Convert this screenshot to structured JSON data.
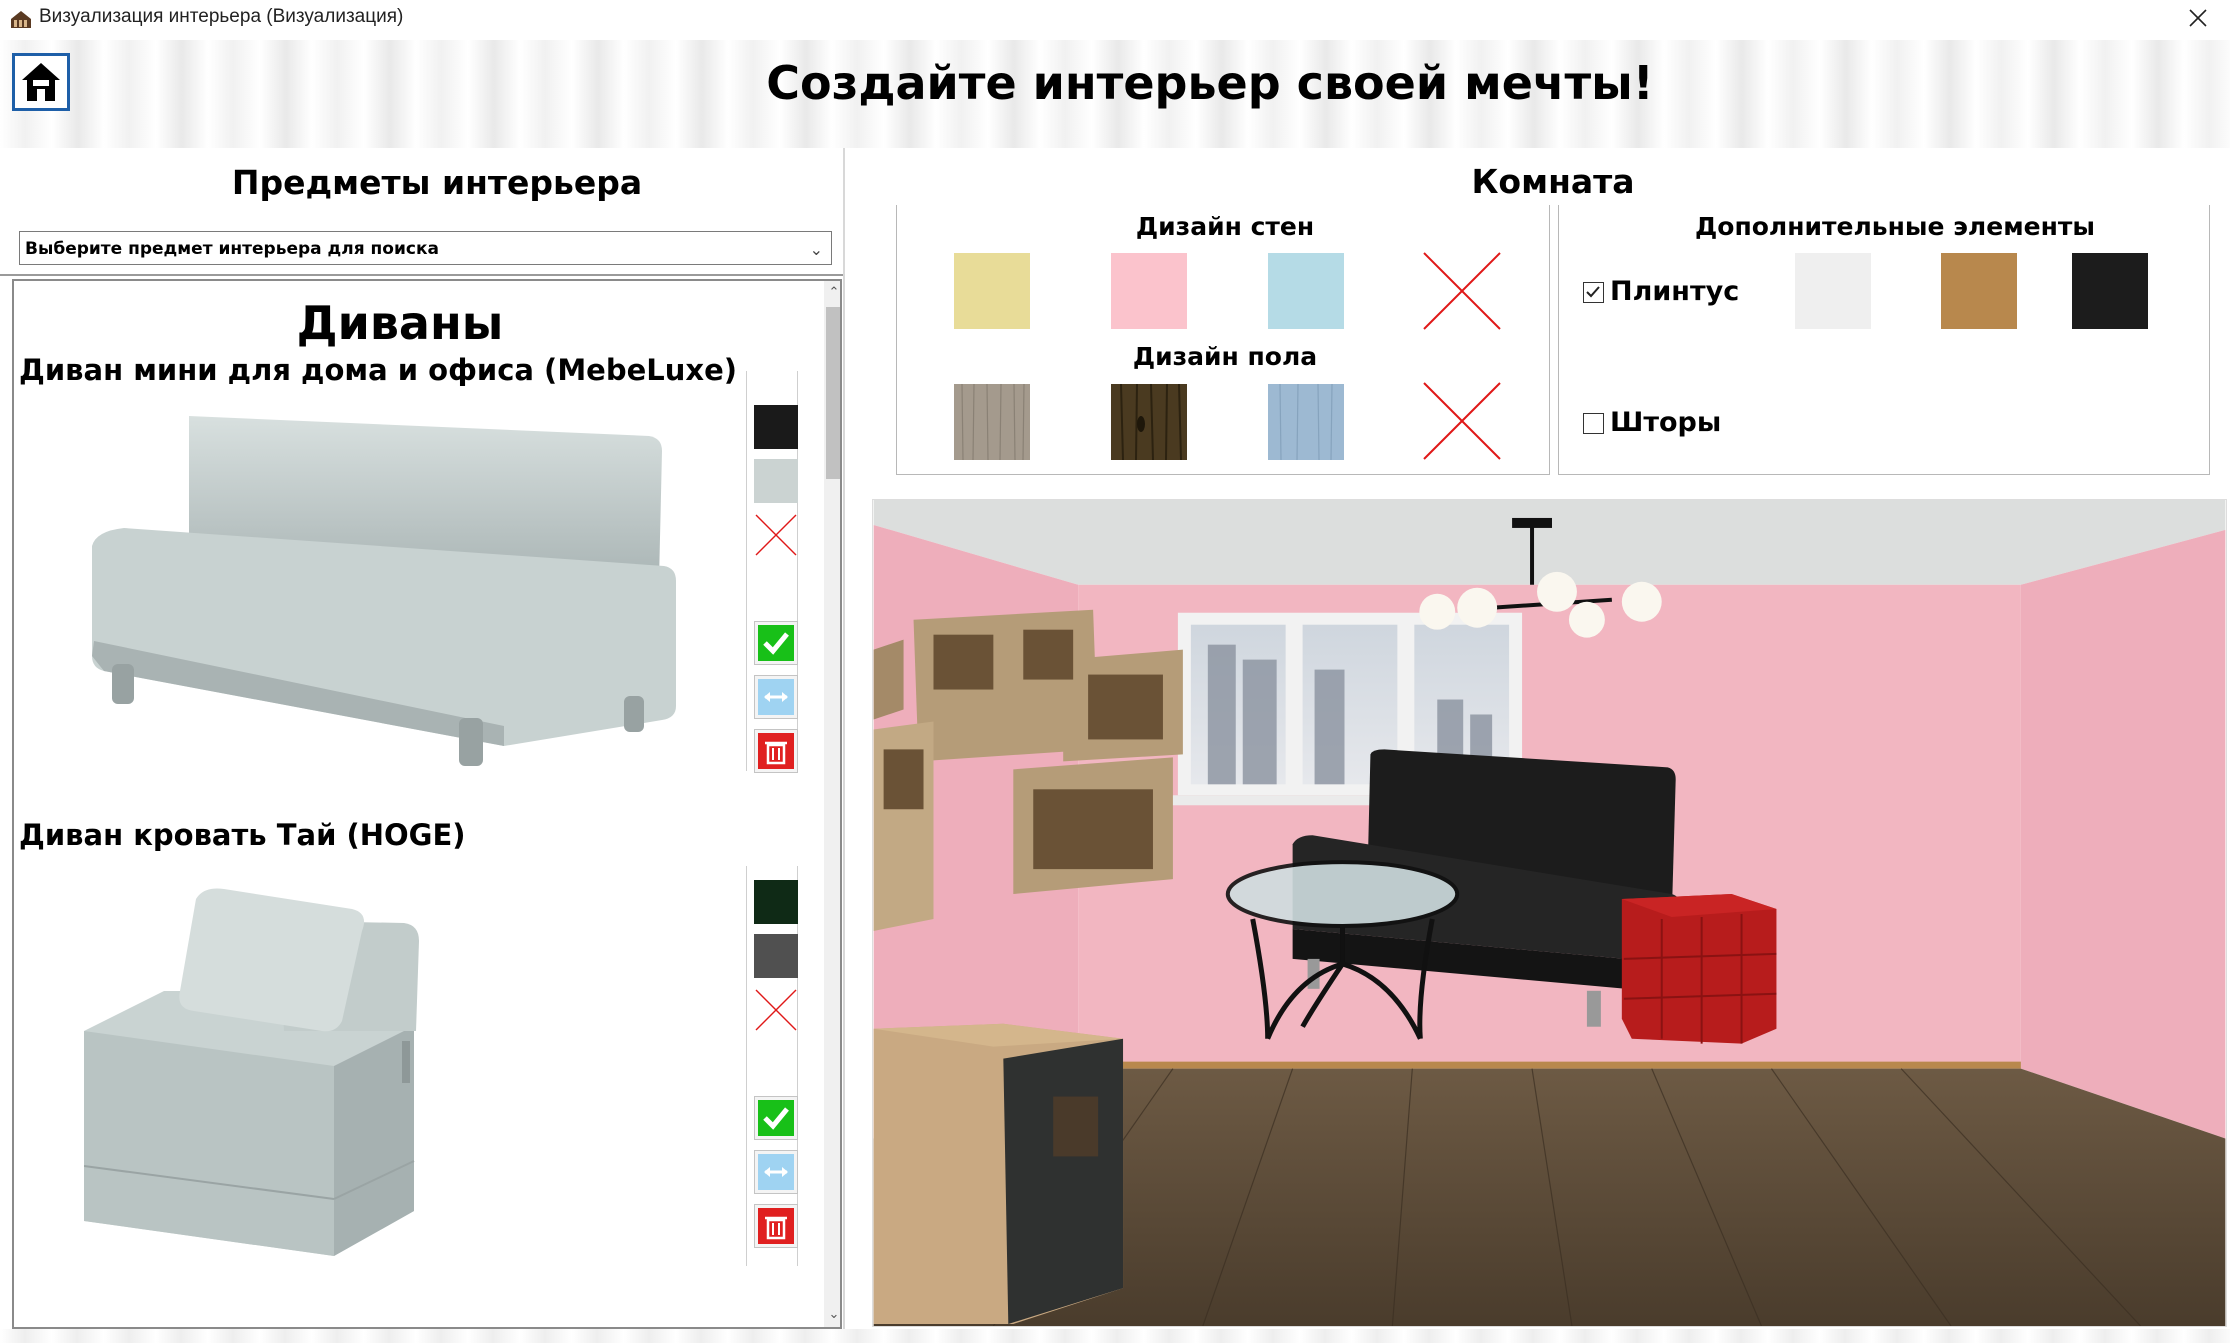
{
  "window": {
    "title": "Визуализация интерьера (Визуализация)"
  },
  "header": {
    "title": "Создайте интерьер своей мечты!"
  },
  "left_panel": {
    "title": "Предметы интерьера",
    "search_placeholder": "Выберите предмет интерьера для поиска",
    "category": "Диваны",
    "items": [
      {
        "name": "Диван мини для дома и офиса (MebeLuxe)",
        "colors": [
          "#1a1a1a",
          "#cbd3d2"
        ]
      },
      {
        "name": "Диван кровать Тай (HOGE)",
        "colors": [
          "#0f2a16",
          "#505050"
        ]
      }
    ]
  },
  "room": {
    "title": "Комната",
    "walls": {
      "label": "Дизайн стен",
      "colors": [
        "#e8dc98",
        "#fbc3cc",
        "#b5dbe6"
      ]
    },
    "floor": {
      "label": "Дизайн пола",
      "textures": [
        "light-wood",
        "dark-wood",
        "blue-wood"
      ]
    },
    "extras": {
      "label": "Дополнительные элементы",
      "baseboard": {
        "label": "Плинтус",
        "checked": true,
        "colors": [
          "#efefef",
          "#b8884d",
          "#1c1c1c"
        ]
      },
      "curtains": {
        "label": "Шторы",
        "checked": false
      }
    }
  },
  "accent": {
    "home_border": "#1e5fa8",
    "remove_x": "#e01818",
    "confirm": "#18c018",
    "delete": "#e02020"
  }
}
